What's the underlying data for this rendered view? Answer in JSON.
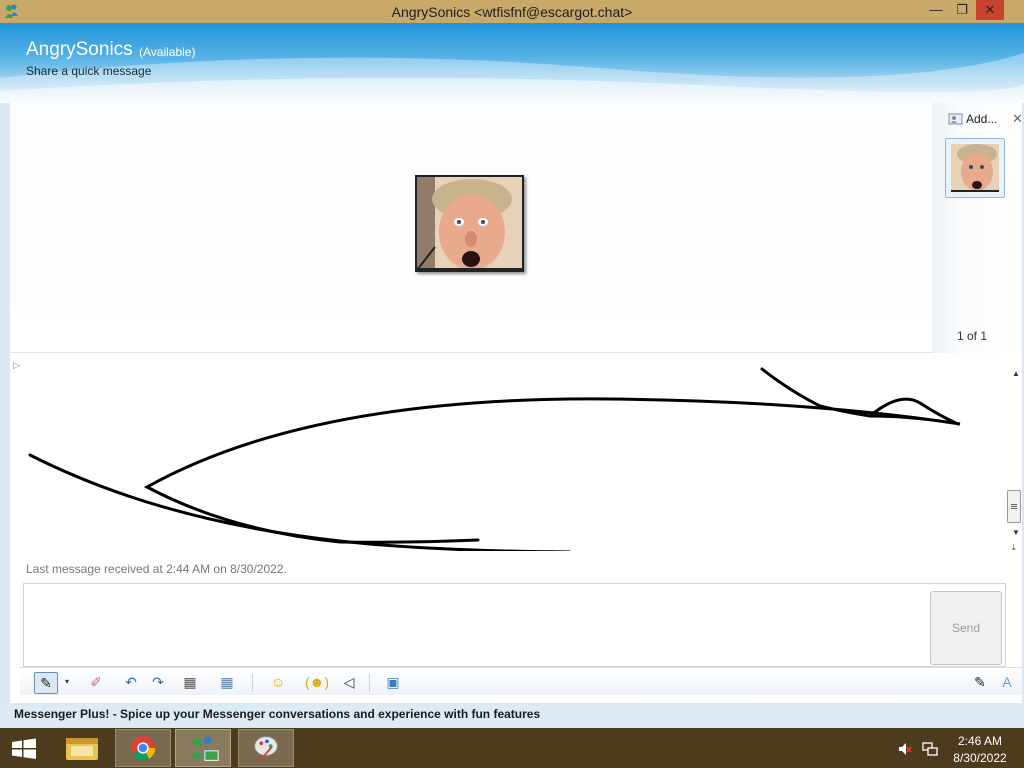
{
  "window": {
    "title": "AngrySonics <wtfisfnf@escargot.chat>",
    "min_glyph": "—",
    "max_glyph": "❐",
    "close_glyph": "✕"
  },
  "header": {
    "contact_name": "AngrySonics",
    "status": "(Available)",
    "quick_message": "Share a quick message"
  },
  "sharing_pane": {
    "add_label": "Add...",
    "close_glyph": "✕",
    "page_count": "1 of 1"
  },
  "conversation": {
    "last_received": "Last message received at 2:44 AM on 8/30/2022."
  },
  "compose": {
    "send_label": "Send"
  },
  "toolbar": {
    "ink_glyph": "✎",
    "dropdown_glyph": "▾",
    "eraser_glyph": "✐",
    "undo_glyph": "↶",
    "redo_glyph": "↷",
    "grid1_glyph": "▦",
    "grid2_glyph": "▦",
    "emoticon_glyph": "☺",
    "wink_glyph": "(☻)",
    "nudge_glyph": "◁",
    "background_glyph": "▣",
    "handwrite_glyph": "✎",
    "font_glyph": "A"
  },
  "plus_bar": {
    "text": "Messenger Plus! - Spice up your Messenger conversations and experience with fun features"
  },
  "taskbar": {
    "time": "2:46 AM",
    "date": "8/30/2022"
  },
  "colors": {
    "titlebar": "#c8a96a",
    "close": "#c7432f",
    "taskbar": "#4d3b1e",
    "header_blue": "#1f94d8"
  }
}
